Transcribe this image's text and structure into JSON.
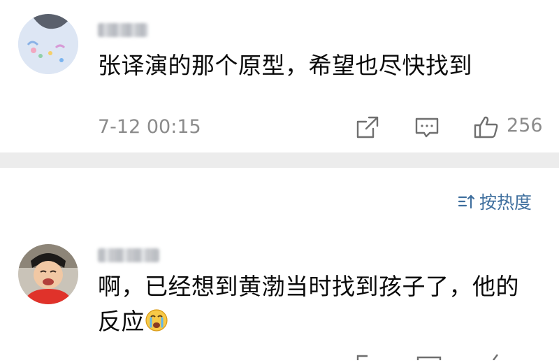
{
  "comments": [
    {
      "text": "张译演的那个原型，希望也尽快找到",
      "time": "7-12 00:15",
      "like_count": "256"
    },
    {
      "text": "啊，已经想到黄渤当时找到孩子了，他的反应"
    }
  ],
  "sort": {
    "label": "按热度"
  },
  "icons": {
    "share": "share-icon",
    "reply": "reply-icon",
    "like": "thumbs-up-icon",
    "sort": "sort-icon",
    "emoji": "crying-face-icon"
  },
  "colors": {
    "meta_text": "#8b8b8b",
    "sort_text": "#3f6f9e",
    "divider": "#ececec"
  }
}
